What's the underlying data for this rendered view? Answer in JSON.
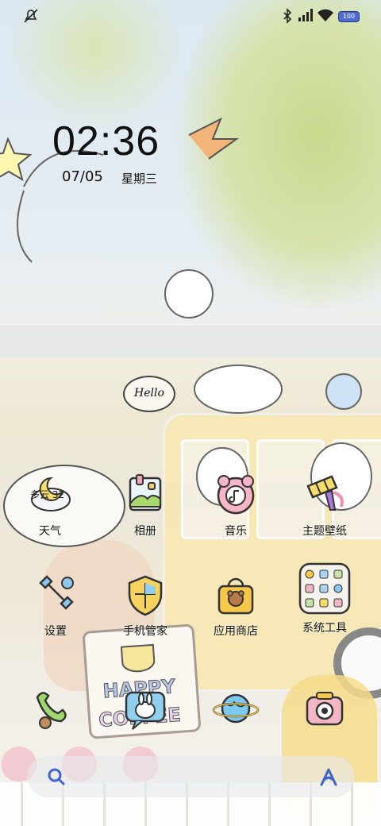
{
  "status_bar": {
    "battery_level": "100",
    "icons": [
      "mute-icon",
      "bluetooth-icon",
      "signal-icon",
      "wifi-icon",
      "battery-icon"
    ]
  },
  "clock": {
    "time": "02:36",
    "date": "07/05",
    "weekday": "星期三"
  },
  "weather": {
    "text": "多云 32"
  },
  "wallpaper": {
    "sign_text": "HAPPY COFFEE",
    "bubble_text": "Hello"
  },
  "apps": [
    {
      "label": "天气",
      "icon": "weather-icon"
    },
    {
      "label": "相册",
      "icon": "gallery-icon"
    },
    {
      "label": "音乐",
      "icon": "music-icon"
    },
    {
      "label": "主题壁纸",
      "icon": "theme-wallpaper-icon"
    },
    {
      "label": "设置",
      "icon": "settings-icon"
    },
    {
      "label": "手机管家",
      "icon": "phone-manager-icon"
    },
    {
      "label": "应用商店",
      "icon": "app-store-icon"
    },
    {
      "label": "系统工具",
      "icon": "system-tools-folder-icon"
    }
  ],
  "dock": [
    {
      "icon": "phone-icon"
    },
    {
      "icon": "messages-icon"
    },
    {
      "icon": "browser-icon"
    },
    {
      "icon": "camera-icon"
    }
  ],
  "search": {
    "left_icon": "search-icon",
    "right_icon": "assistant-icon"
  },
  "colors": {
    "accent": "#4f6bd8",
    "text": "#111111"
  }
}
